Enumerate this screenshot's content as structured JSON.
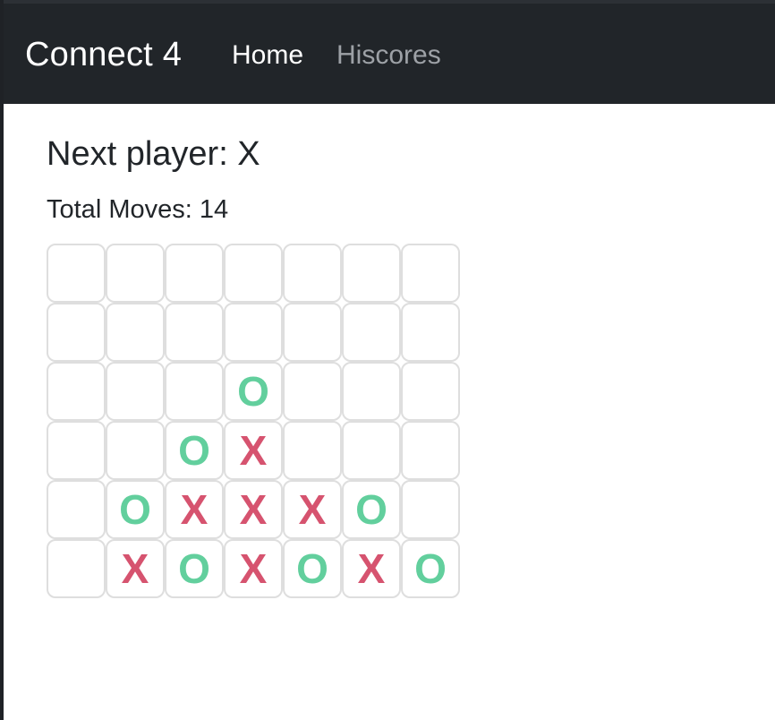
{
  "navbar": {
    "brand": "Connect 4",
    "links": [
      {
        "label": "Home",
        "active": true
      },
      {
        "label": "Hiscores",
        "active": false
      }
    ]
  },
  "game": {
    "next_player_text": "Next player: X",
    "total_moves_text": "Total Moves: 14",
    "colors": {
      "X": "#d6536f",
      "O": "#62cf9d"
    },
    "board": [
      [
        "",
        "",
        "",
        "",
        "",
        "",
        ""
      ],
      [
        "",
        "",
        "",
        "",
        "",
        "",
        ""
      ],
      [
        "",
        "",
        "",
        "O",
        "",
        "",
        ""
      ],
      [
        "",
        "",
        "O",
        "X",
        "",
        "",
        ""
      ],
      [
        "",
        "O",
        "X",
        "X",
        "X",
        "O",
        ""
      ],
      [
        "",
        "X",
        "O",
        "X",
        "O",
        "X",
        "O"
      ]
    ]
  }
}
